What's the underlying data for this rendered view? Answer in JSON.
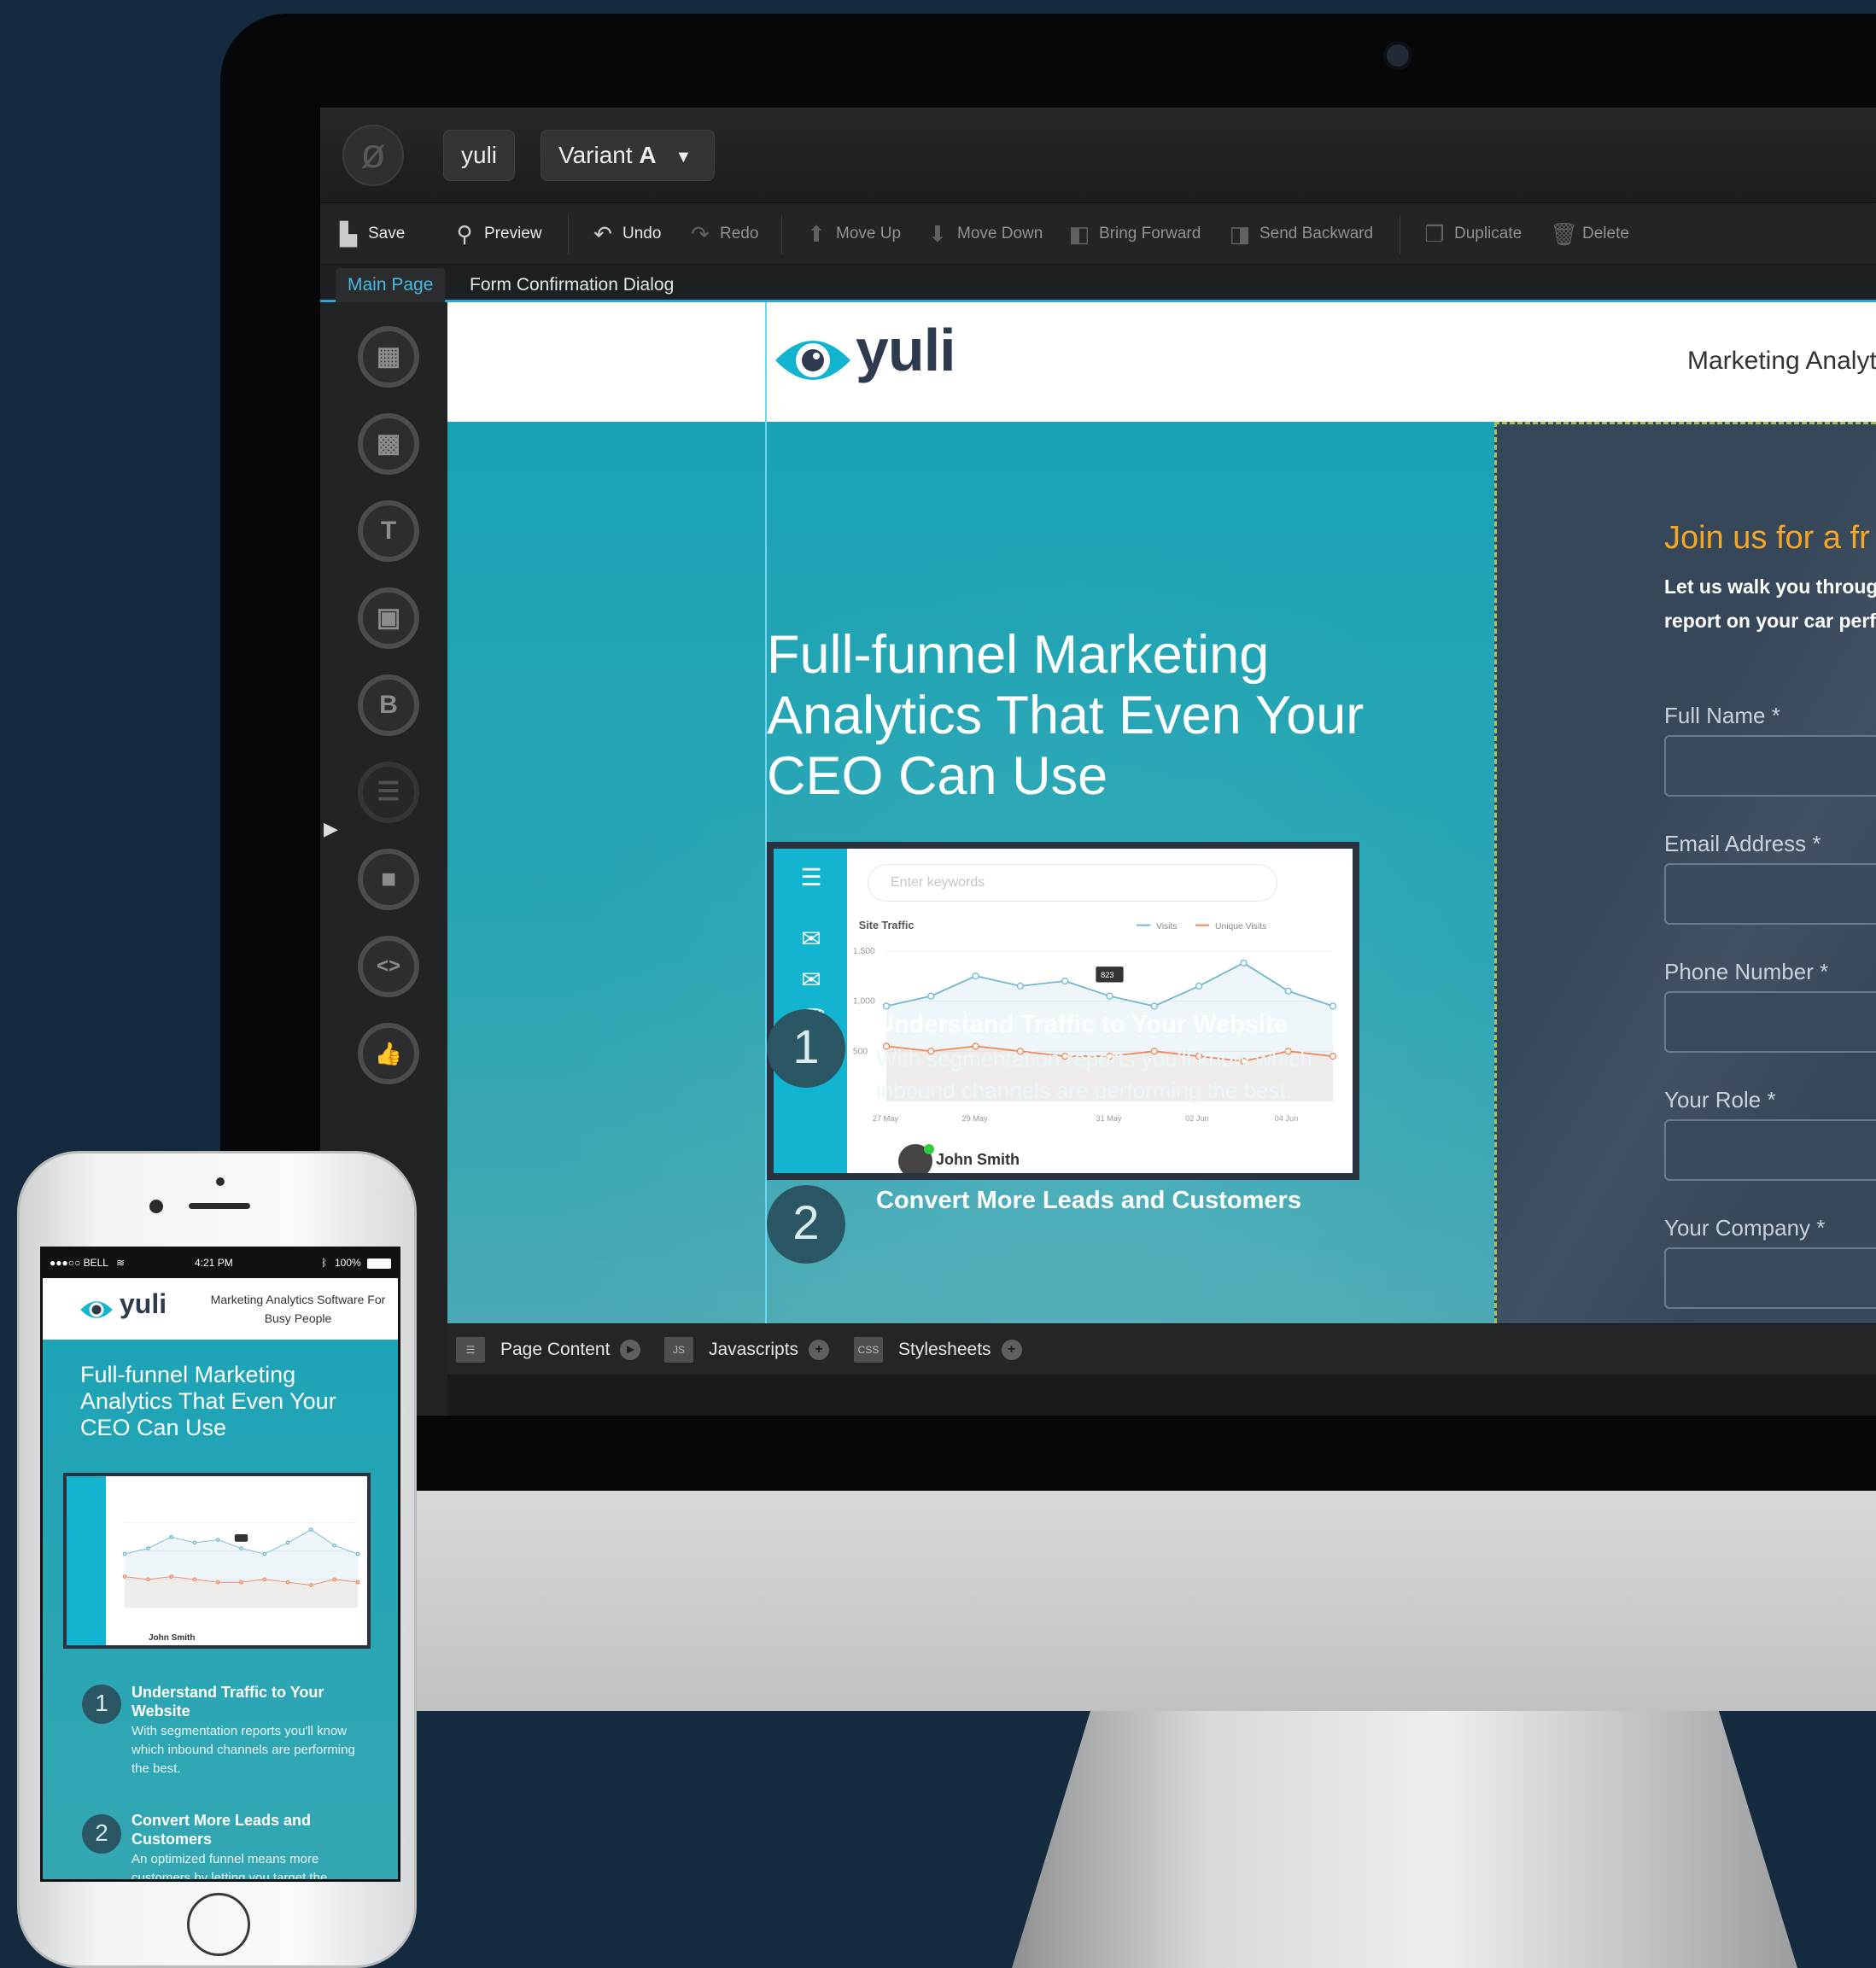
{
  "editor": {
    "app_name": "yuli",
    "variant_label": "Variant",
    "variant_value": "A",
    "logo_glyph": "ø",
    "toolbar": [
      {
        "id": "save",
        "label": "Save",
        "icon": "save-icon",
        "enabled": true
      },
      {
        "id": "preview",
        "label": "Preview",
        "icon": "search-icon",
        "enabled": true
      },
      {
        "id": "undo",
        "label": "Undo",
        "icon": "undo-icon",
        "enabled": true
      },
      {
        "id": "redo",
        "label": "Redo",
        "icon": "redo-icon",
        "enabled": false
      },
      {
        "id": "move_up",
        "label": "Move Up",
        "icon": "move-up-icon",
        "enabled": false
      },
      {
        "id": "move_down",
        "label": "Move Down",
        "icon": "move-down-icon",
        "enabled": false
      },
      {
        "id": "bring_forward",
        "label": "Bring Forward",
        "icon": "bring-forward-icon",
        "enabled": false
      },
      {
        "id": "send_backward",
        "label": "Send Backward",
        "icon": "send-backward-icon",
        "enabled": false
      },
      {
        "id": "duplicate",
        "label": "Duplicate",
        "icon": "duplicate-icon",
        "enabled": false
      },
      {
        "id": "delete",
        "label": "Delete",
        "icon": "delete-icon",
        "enabled": false
      }
    ],
    "tabs": [
      {
        "label": "Main Page",
        "active": true
      },
      {
        "label": "Form Confirmation Dialog",
        "active": false
      }
    ],
    "tools": [
      {
        "name": "section-tool-icon",
        "glyph": "▦"
      },
      {
        "name": "box-tool-icon",
        "glyph": "▩"
      },
      {
        "name": "text-tool-icon",
        "glyph": "T"
      },
      {
        "name": "image-tool-icon",
        "glyph": "▣"
      },
      {
        "name": "button-tool-icon",
        "glyph": "B"
      },
      {
        "name": "form-tool-icon",
        "glyph": "☰"
      },
      {
        "name": "video-tool-icon",
        "glyph": "■"
      },
      {
        "name": "custom-html-tool-icon",
        "glyph": "<>"
      },
      {
        "name": "social-widget-tool-icon",
        "glyph": "👍"
      }
    ],
    "bottombar": {
      "page_content": "Page Content",
      "javascripts": "Javascripts",
      "js_badge": "JS",
      "stylesheets": "Stylesheets",
      "css_badge": "CSS"
    },
    "accent": "#2aa6cf"
  },
  "landing": {
    "brand": "yuli",
    "nav_tagline": "Marketing Analyt",
    "headline": "Full-funnel Marketing Analytics That Even Your CEO Can Use",
    "dashboard": {
      "search_placeholder": "Enter keywords",
      "chart_title": "Site Traffic",
      "legend": [
        "Visits",
        "Unique Visits"
      ],
      "tooltip": "823",
      "user": "John Smith"
    },
    "features": [
      {
        "num": "1",
        "title": "Understand Traffic to Your Website",
        "body": "With segmentation reports you'll know which inbound channels are performing the best."
      },
      {
        "num": "2",
        "title": "Convert More Leads and Customers",
        "body": ""
      }
    ],
    "form": {
      "heading": "Join us for a fr",
      "description": "Let us walk you throug show you how easily y and report on your car performance.",
      "fields": [
        "Full Name *",
        "Email Address *",
        "Phone Number *",
        "Your Role *",
        "Your Company *"
      ]
    },
    "colors": {
      "hero": "#1aa3b4",
      "form_bg": "#37475a",
      "form_heading": "#f5a623",
      "brand_dark": "#2e3b4e"
    }
  },
  "phone": {
    "carrier": "●●●○○ BELL",
    "time": "4:21 PM",
    "battery": "100%",
    "brand": "yuli",
    "tagline": "Marketing Analytics Software For Busy People",
    "headline": "Full-funnel Marketing Analytics That Even Your CEO Can Use",
    "user": "John Smith",
    "features": [
      {
        "num": "1",
        "title": "Understand Traffic to Your Website",
        "body": "With segmentation reports you'll know which inbound channels are performing the best."
      },
      {
        "num": "2",
        "title": "Convert More Leads and Customers",
        "body": "An optimized funnel means more customers by letting you target the"
      }
    ]
  },
  "chart_data": {
    "type": "line",
    "title": "Site Traffic",
    "categories": [
      "27 May",
      "",
      "29 May",
      "",
      "",
      "31 May",
      "",
      "02 Jun",
      "",
      "04 Jun",
      ""
    ],
    "tick_labels": [
      "27 May",
      "29 May",
      "31 May",
      "02 Jun",
      "04 Jun"
    ],
    "series": [
      {
        "name": "Visits",
        "color": "#74b9cf",
        "values": [
          950,
          1050,
          1250,
          1150,
          1200,
          1050,
          950,
          1150,
          1380,
          1100,
          950
        ]
      },
      {
        "name": "Unique Visits",
        "color": "#f2865a",
        "values": [
          550,
          500,
          550,
          500,
          450,
          450,
          500,
          450,
          400,
          500,
          450
        ]
      }
    ],
    "y_ticks": [
      "1,500",
      "1,000",
      "500"
    ],
    "ylim": [
      0,
      1600
    ],
    "tooltip": {
      "index": 5,
      "label": "823"
    },
    "grid": true,
    "legend_position": "top-right"
  }
}
